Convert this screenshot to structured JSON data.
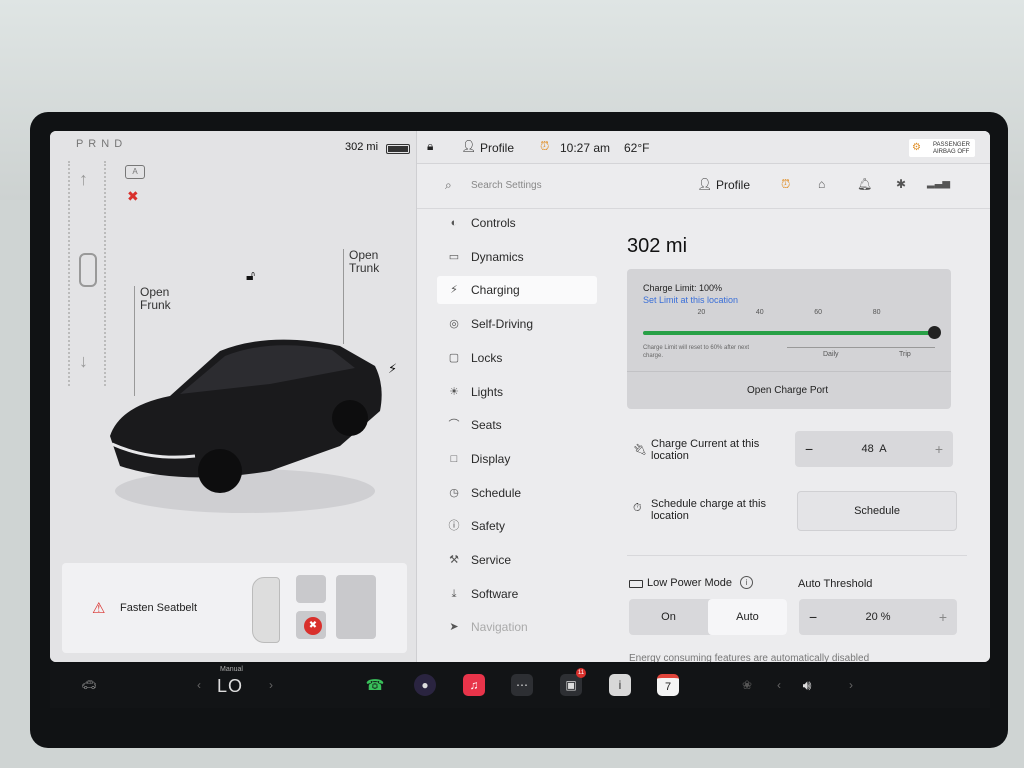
{
  "status": {
    "gear": "P R N D",
    "range": "302 mi",
    "profile": "Profile",
    "time": "10:27 am",
    "temp": "62°F",
    "airbag_line1": "PASSENGER",
    "airbag_line2": "AIRBAG OFF"
  },
  "car": {
    "frunk_line1": "Open",
    "frunk_line2": "Frunk",
    "trunk_line1": "Open",
    "trunk_line2": "Trunk",
    "alert": "Fasten Seatbelt"
  },
  "search": {
    "placeholder": "Search Settings",
    "profile": "Profile"
  },
  "menu": [
    {
      "label": "Controls",
      "icon": "toggle-icon"
    },
    {
      "label": "Dynamics",
      "icon": "car-icon"
    },
    {
      "label": "Charging",
      "icon": "bolt-icon"
    },
    {
      "label": "Self-Driving",
      "icon": "steering-wheel-icon"
    },
    {
      "label": "Locks",
      "icon": "lock-icon"
    },
    {
      "label": "Lights",
      "icon": "sun-icon"
    },
    {
      "label": "Seats",
      "icon": "seat-icon"
    },
    {
      "label": "Display",
      "icon": "display-icon"
    },
    {
      "label": "Schedule",
      "icon": "clock-icon"
    },
    {
      "label": "Safety",
      "icon": "safety-icon"
    },
    {
      "label": "Service",
      "icon": "wrench-icon"
    },
    {
      "label": "Software",
      "icon": "download-icon"
    },
    {
      "label": "Navigation",
      "icon": "navigation-icon"
    }
  ],
  "active_menu": "Charging",
  "charging": {
    "range": "302 mi",
    "limit_label": "Charge Limit: 100%",
    "limit_level": 1.0,
    "set_limit": "Set Limit at this location",
    "ticks": [
      "20",
      "40",
      "60",
      "80"
    ],
    "reset_note_line1": "Charge Limit will reset to 60% after next",
    "reset_note_line2": "charge.",
    "daily": "Daily",
    "trip": "Trip",
    "open_port": "Open Charge Port",
    "current_line1": "Charge Current at this",
    "current_line2": "location",
    "current_value": "48  A",
    "minus": "−",
    "plus": "+",
    "schedule_line1": "Schedule charge at this",
    "schedule_line2": "location",
    "schedule_button": "Schedule",
    "low_power_label": "Low Power Mode",
    "auto_threshold": "Auto Threshold",
    "on": "On",
    "auto": "Auto",
    "threshold_value": "20 %",
    "energy_note": "Energy consuming features are automatically disabled"
  },
  "dock": {
    "manual": "Manual",
    "temp_setting": "LO",
    "calendar_day": "7",
    "camera_badge": "11"
  },
  "colors": {
    "accent_green": "#28a046",
    "alert_red": "#d9302c",
    "link_blue": "#3a6fd8"
  }
}
